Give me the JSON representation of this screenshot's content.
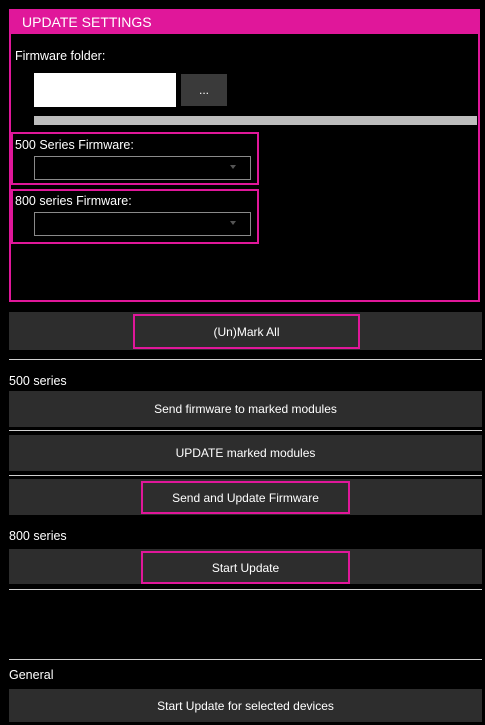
{
  "settings": {
    "title": "UPDATE SETTINGS",
    "firmware_folder_label": "Firmware folder:",
    "firmware_folder_value": "",
    "browse_label": "...",
    "series500_label": "500 Series Firmware:",
    "series500_selected": "",
    "series800_label": "800 series Firmware:",
    "series800_selected": ""
  },
  "actions": {
    "unmark_all": "(Un)Mark All"
  },
  "series500": {
    "heading": "500 series",
    "send_firmware": "Send firmware to marked modules",
    "update_marked": "UPDATE marked modules",
    "send_and_update": "Send and Update Firmware"
  },
  "series800": {
    "heading": "800 series",
    "start_update": "Start Update"
  },
  "general": {
    "heading": "General",
    "start_update_selected": "Start Update for selected devices"
  },
  "colors": {
    "accent": "#e0179a",
    "button_bg": "#2d2d2d",
    "background": "#000000"
  }
}
